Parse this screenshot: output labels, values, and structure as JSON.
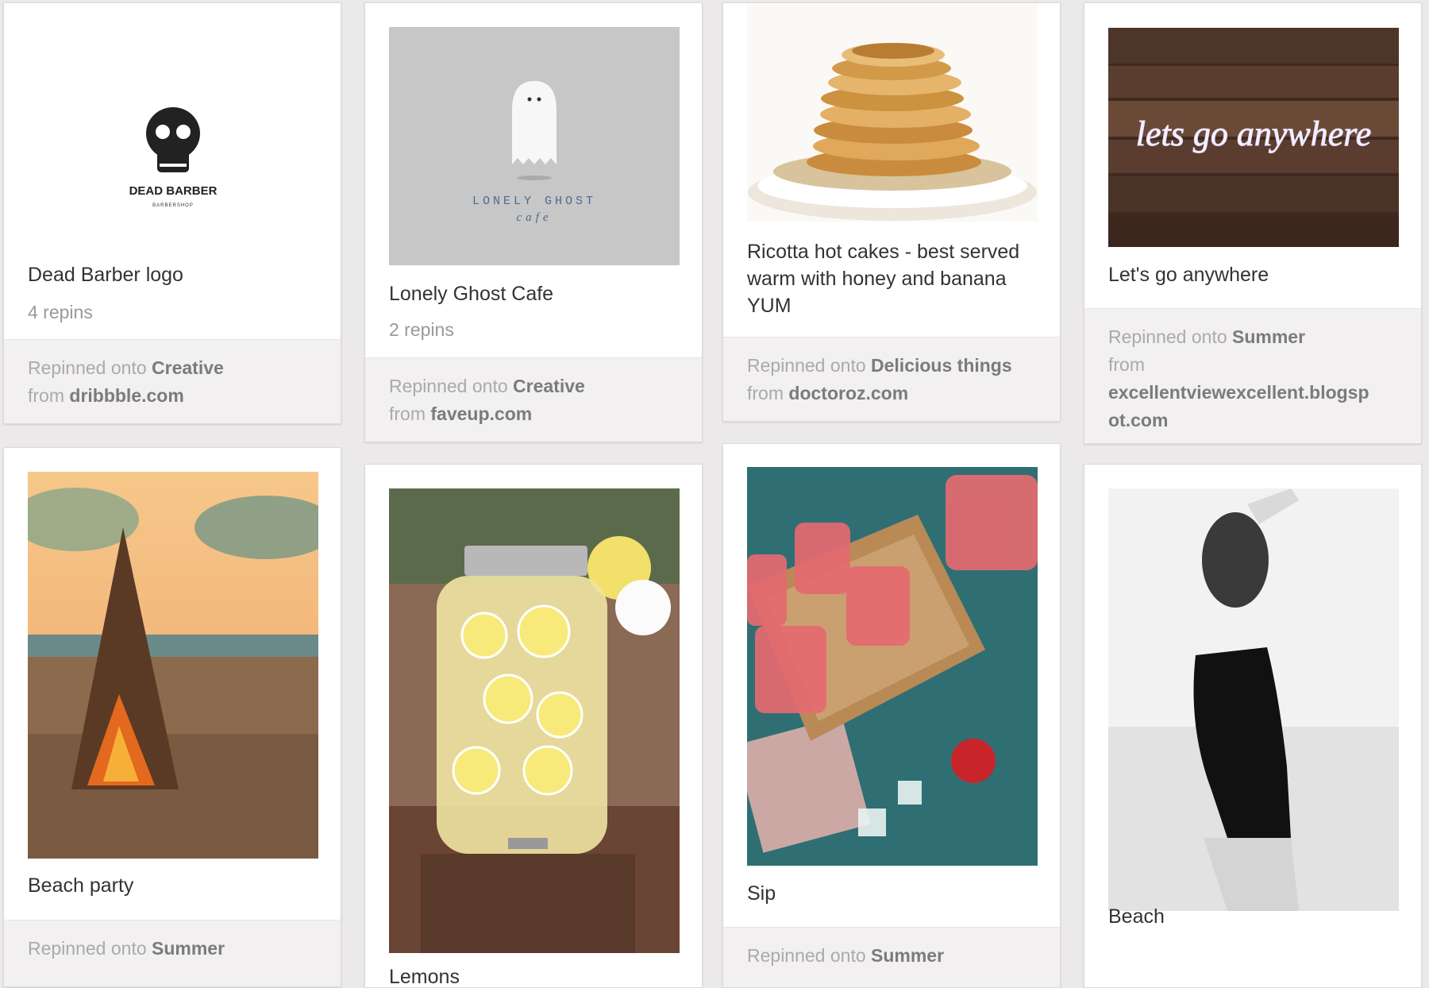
{
  "labels": {
    "repinned_onto": "Repinned onto",
    "from": "from"
  },
  "pins": [
    {
      "description": "Dead Barber logo",
      "repins": "4 repins",
      "board": "Creative",
      "source": "dribbble.com",
      "image": {
        "title": "DEAD BARBER",
        "subtitle": "BARBERSHOP"
      }
    },
    {
      "description": "Lonely Ghost Cafe",
      "repins": "2 repins",
      "board": "Creative",
      "source": "faveup.com",
      "image": {
        "title": "LONELY GHOST",
        "subtitle": "cafe"
      }
    },
    {
      "description": "Ricotta hot cakes - best served warm with honey and banana YUM",
      "board": "Delicious things",
      "source": "doctoroz.com"
    },
    {
      "description": "Let's go anywhere",
      "board": "Summer",
      "source": "excellentviewexcellent.blogspot.com",
      "image": {
        "neon_text": "lets go anywhere"
      }
    },
    {
      "description": "Beach party",
      "board": "Summer"
    },
    {
      "description": "Lemons"
    },
    {
      "description": "Sip",
      "board": "Summer"
    },
    {
      "description": "Beach"
    }
  ]
}
